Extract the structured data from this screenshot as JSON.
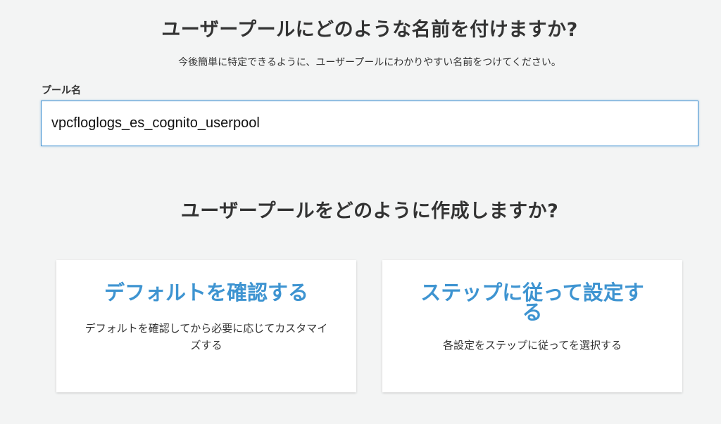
{
  "header": {
    "question_name": "ユーザープールにどのような名前を付けますか?",
    "hint": "今後簡単に特定できるように、ユーザープールにわかりやすい名前をつけてください。"
  },
  "pool_name": {
    "label": "プール名",
    "value": "vpcfloglogs_es_cognito_userpool"
  },
  "creation": {
    "question": "ユーザープールをどのように作成しますか?",
    "options": [
      {
        "title": "デフォルトを確認する",
        "description": "デフォルトを確認してから必要に応じてカスタマイズする"
      },
      {
        "title": "ステップに従って設定する",
        "description": "各設定をステップに従ってを選択する"
      }
    ]
  },
  "colors": {
    "accent": "#3e94d1",
    "focus_border": "#3c8fd0",
    "background": "#f3f4f4"
  }
}
